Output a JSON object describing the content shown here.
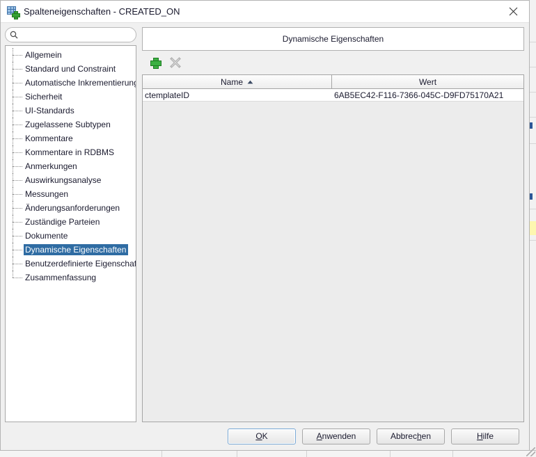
{
  "window": {
    "title": "Spalteneigenschaften - CREATED_ON",
    "app_icon": "column-properties-icon",
    "close_icon": "close-icon"
  },
  "sidebar": {
    "search": {
      "icon": "search-icon",
      "value": "",
      "placeholder": ""
    },
    "items": [
      {
        "label": "Allgemein",
        "selected": false
      },
      {
        "label": "Standard und Constraint",
        "selected": false
      },
      {
        "label": "Automatische Inkrementierung",
        "selected": false
      },
      {
        "label": "Sicherheit",
        "selected": false
      },
      {
        "label": "UI-Standards",
        "selected": false
      },
      {
        "label": "Zugelassene Subtypen",
        "selected": false
      },
      {
        "label": "Kommentare",
        "selected": false
      },
      {
        "label": "Kommentare in RDBMS",
        "selected": false
      },
      {
        "label": "Anmerkungen",
        "selected": false
      },
      {
        "label": "Auswirkungsanalyse",
        "selected": false
      },
      {
        "label": "Messungen",
        "selected": false
      },
      {
        "label": "Änderungsanforderungen",
        "selected": false
      },
      {
        "label": "Zuständige Parteien",
        "selected": false
      },
      {
        "label": "Dokumente",
        "selected": false
      },
      {
        "label": "Dynamische Eigenschaften",
        "selected": true
      },
      {
        "label": "Benutzerdefinierte Eigenschaften",
        "selected": false
      },
      {
        "label": "Zusammenfassung",
        "selected": false
      }
    ],
    "selection_color": "#2f6ca3"
  },
  "main": {
    "panel_title": "Dynamische Eigenschaften",
    "toolbar": [
      {
        "name": "add-property-button",
        "icon": "plus-icon",
        "enabled": true
      },
      {
        "name": "delete-property-button",
        "icon": "delete-x-icon",
        "enabled": false
      }
    ],
    "table": {
      "columns": [
        {
          "label": "Name",
          "sort": "ascending",
          "sort_icon": "sort-ascending-icon"
        },
        {
          "label": "Wert",
          "sort": "none"
        }
      ],
      "rows": [
        {
          "name": "ctemplateID",
          "value": "6AB5EC42-F116-7366-045C-D9FD75170A21"
        }
      ]
    }
  },
  "footer": {
    "buttons": [
      {
        "label": "OK",
        "mnemonic": "O",
        "default": true,
        "name": "ok-button"
      },
      {
        "label": "Anwenden",
        "mnemonic": "A",
        "default": false,
        "name": "apply-button"
      },
      {
        "label": "Abbrechen",
        "mnemonic": "h",
        "default": false,
        "name": "cancel-button"
      },
      {
        "label": "Hilfe",
        "mnemonic": "H",
        "default": false,
        "name": "help-button"
      }
    ]
  }
}
